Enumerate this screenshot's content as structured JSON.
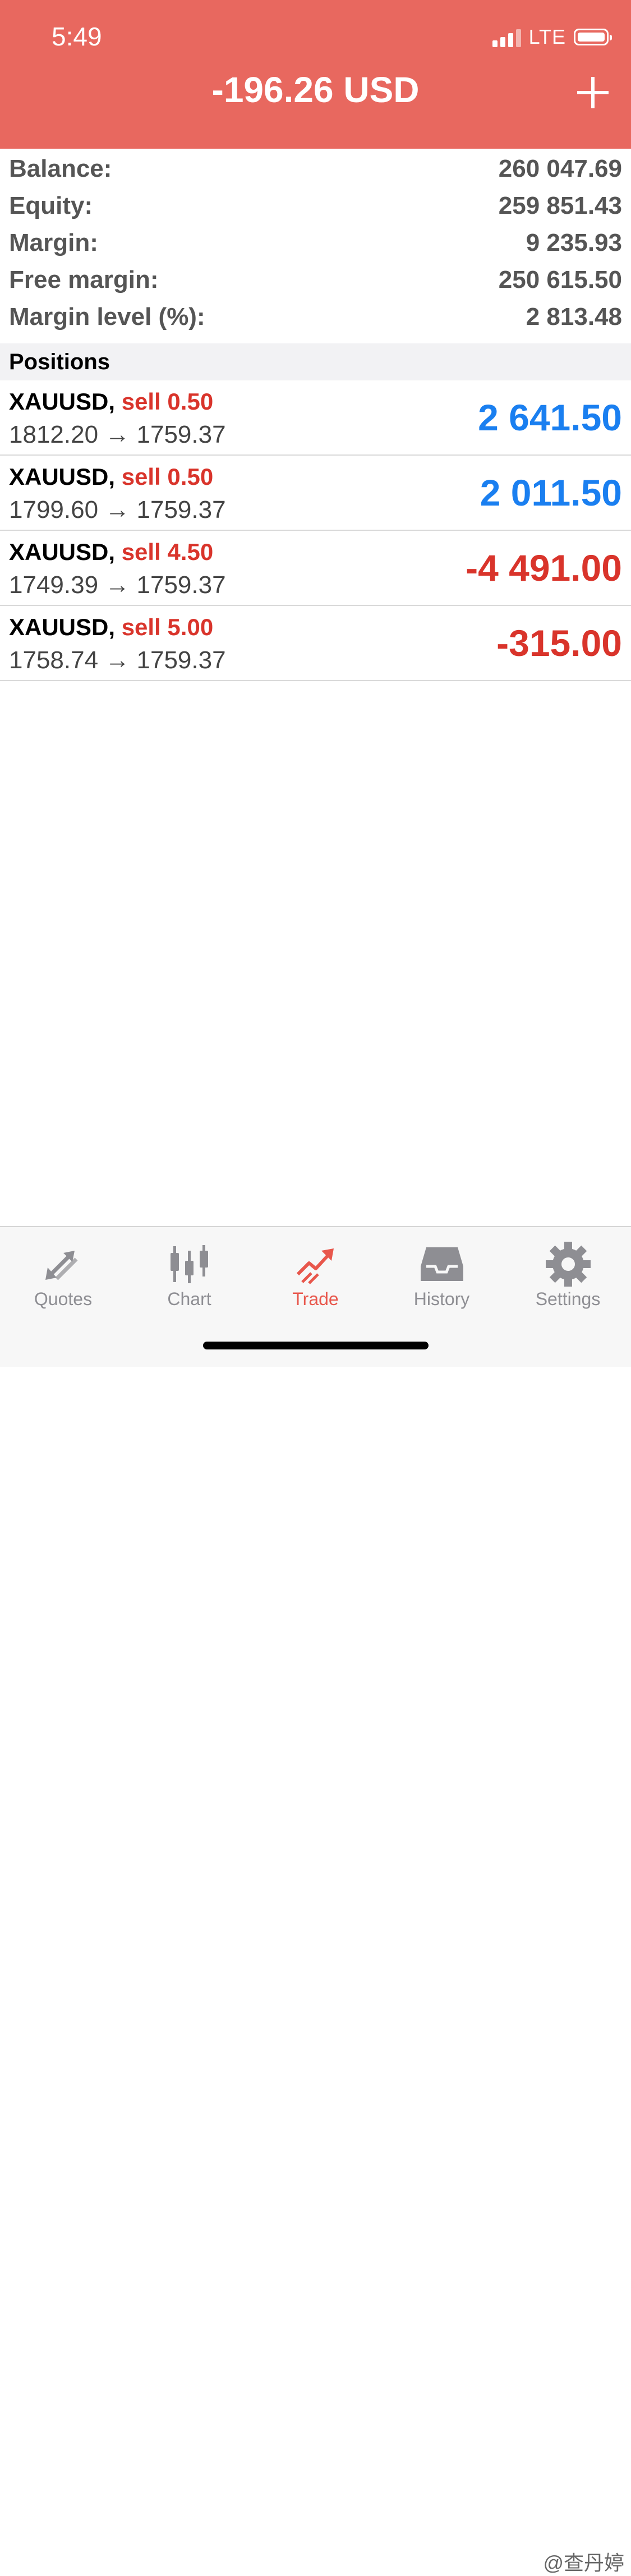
{
  "status_bar": {
    "time": "5:49",
    "network": "LTE"
  },
  "header": {
    "title": "-196.26 USD"
  },
  "summary": [
    {
      "label": "Balance:",
      "value": "260 047.69"
    },
    {
      "label": "Equity:",
      "value": "259 851.43"
    },
    {
      "label": "Margin:",
      "value": "9 235.93"
    },
    {
      "label": "Free margin:",
      "value": "250 615.50"
    },
    {
      "label": "Margin level (%):",
      "value": "2 813.48"
    }
  ],
  "positions_header": "Positions",
  "positions": [
    {
      "symbol": "XAUUSD,",
      "side": "sell 0.50",
      "prices": "1812.20 → 1759.37",
      "profit": "2 641.50",
      "profit_sign": "positive"
    },
    {
      "symbol": "XAUUSD,",
      "side": "sell 0.50",
      "prices": "1799.60 → 1759.37",
      "profit": "2 011.50",
      "profit_sign": "positive"
    },
    {
      "symbol": "XAUUSD,",
      "side": "sell 4.50",
      "prices": "1749.39 → 1759.37",
      "profit": "-4 491.00",
      "profit_sign": "negative"
    },
    {
      "symbol": "XAUUSD,",
      "side": "sell 5.00",
      "prices": "1758.74 → 1759.37",
      "profit": "-315.00",
      "profit_sign": "negative"
    }
  ],
  "tabs": [
    {
      "label": "Quotes",
      "icon": "quotes-arrows-icon",
      "active": false
    },
    {
      "label": "Chart",
      "icon": "candlestick-icon",
      "active": false
    },
    {
      "label": "Trade",
      "icon": "trade-trend-icon",
      "active": true
    },
    {
      "label": "History",
      "icon": "inbox-tray-icon",
      "active": false
    },
    {
      "label": "Settings",
      "icon": "gear-icon",
      "active": false
    }
  ],
  "watermark": "@查丹婷",
  "colors": {
    "header": "#e8685f",
    "profit_positive": "#1a7ff0",
    "profit_negative": "#d9342b",
    "tab_active": "#e8574c",
    "tab_inactive": "#8e8e93"
  }
}
